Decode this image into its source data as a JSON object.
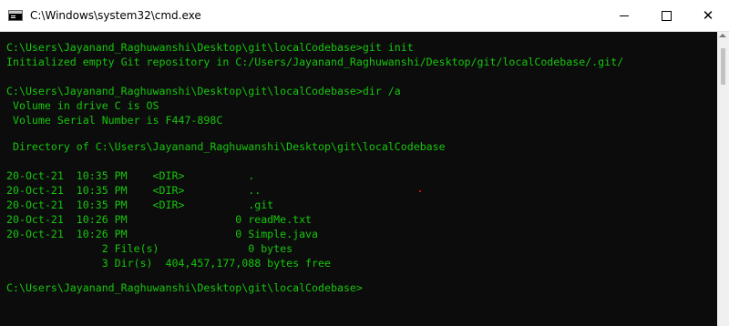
{
  "window": {
    "title": "C:\\Windows\\system32\\cmd.exe",
    "icon": "cmd-console-icon",
    "controls": {
      "minimize_icon": "minimize-icon",
      "maximize_icon": "maximize-icon",
      "close_label": "✕"
    }
  },
  "console": {
    "text_color": "#16c60c",
    "background": "#0c0c0c",
    "lines": [
      "C:\\Users\\Jayanand_Raghuwanshi\\Desktop\\git\\localCodebase>git init",
      "Initialized empty Git repository in C:/Users/Jayanand_Raghuwanshi/Desktop/git/localCodebase/.git/",
      "",
      "C:\\Users\\Jayanand_Raghuwanshi\\Desktop\\git\\localCodebase>dir /a",
      " Volume in drive C is OS",
      " Volume Serial Number is F447-898C",
      "",
      " Directory of C:\\Users\\Jayanand_Raghuwanshi\\Desktop\\git\\localCodebase",
      "",
      "20-Oct-21  10:35 PM    <DIR>          .",
      "20-Oct-21  10:35 PM    <DIR>          ..",
      "20-Oct-21  10:35 PM    <DIR>          .git",
      "20-Oct-21  10:26 PM                 0 readMe.txt",
      "20-Oct-21  10:26 PM                 0 Simple.java",
      "               2 File(s)              0 bytes",
      "               3 Dir(s)  404,457,177,088 bytes free",
      "",
      "C:\\Users\\Jayanand_Raghuwanshi\\Desktop\\git\\localCodebase>"
    ]
  }
}
